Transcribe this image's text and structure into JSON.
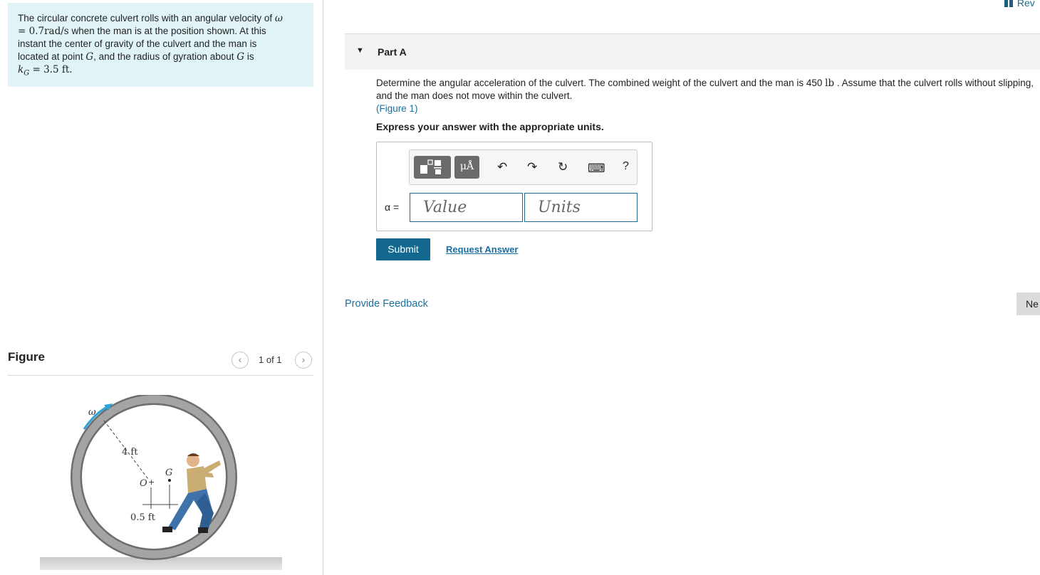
{
  "problem": {
    "line1": "The circular concrete culvert rolls with an angular velocity of",
    "omega": "ω",
    "line2_math": "= 0.7rad/s",
    "line2_text": " when the man is at the position shown. At this",
    "line3": "instant the center of gravity of the culvert and the man is",
    "line4_text": "located at point ",
    "G": "G",
    "line4_text_b": ", and the radius of gyration about ",
    "line4_text_c": " is",
    "kG": "k",
    "kG_sub": "G",
    "kG_value": " = 3.5 ft."
  },
  "figure": {
    "title": "Figure",
    "pager_prev": "‹",
    "pager_count": "1 of 1",
    "pager_next": "›",
    "label_omega": "ω",
    "label_4ft": "4 ft",
    "label_O": "O",
    "label_G": "G",
    "label_05ft": "0.5 ft"
  },
  "header": {
    "review": "Rev"
  },
  "part": {
    "caret": "▼",
    "title": "Part A",
    "question_a": "Determine the angular acceleration of the culvert. The combined weight of the culvert and the man is 450 ",
    "question_unit": "lb",
    "question_b": " . Assume that the culvert rolls without slipping, and the man does not move within the culvert.",
    "figure_link": "(Figure 1)",
    "instruction": "Express your answer with the appropriate units."
  },
  "toolbar": {
    "units_label": "μÅ",
    "undo": "↶",
    "redo": "↷",
    "reset": "↻",
    "keyboard": "⌨",
    "help": "?"
  },
  "answer": {
    "alpha_label": "α =",
    "value_placeholder": "Value",
    "units_placeholder": "Units"
  },
  "actions": {
    "submit": "Submit",
    "request_answer": "Request Answer",
    "provide_feedback": "Provide Feedback",
    "next": "Ne"
  },
  "colors": {
    "problem_bg": "#e0f4f8",
    "primary": "#12688f",
    "link": "#1a6fa0"
  }
}
